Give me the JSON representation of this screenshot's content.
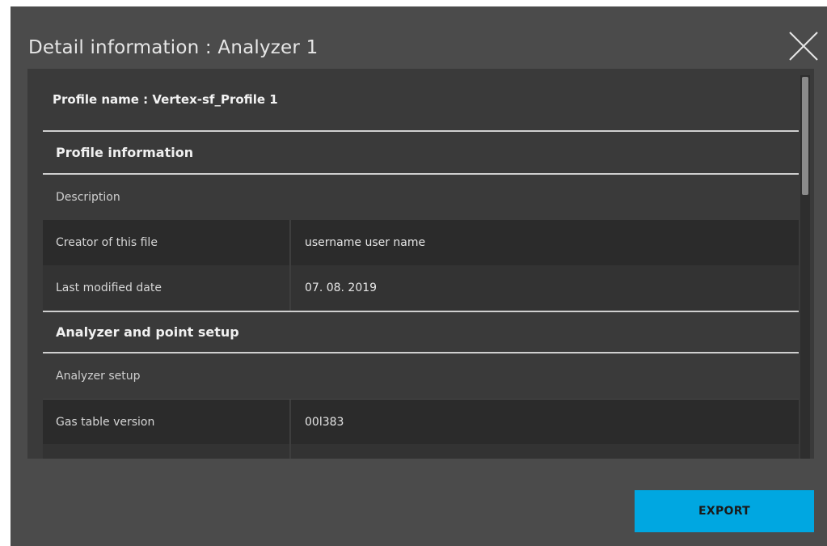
{
  "dialog": {
    "title": "Detail information : Analyzer 1",
    "close_icon": "close-icon"
  },
  "profile": {
    "name_label": "Profile name : Vertex-sf_Profile 1"
  },
  "sections": {
    "profile_information": {
      "header": "Profile information",
      "sub_header": "Description",
      "rows": [
        {
          "label": "Creator of this file",
          "value": "username user name"
        },
        {
          "label": "Last modified date",
          "value": "07. 08. 2019"
        }
      ]
    },
    "analyzer_point_setup": {
      "header": "Analyzer and point setup",
      "sub_header": "Analyzer setup",
      "rows": [
        {
          "label": "Gas table version",
          "value": "00l383"
        },
        {
          "label": "",
          "value": ""
        }
      ]
    }
  },
  "actions": {
    "export_label": "EXPORT"
  },
  "colors": {
    "dialog_bg": "#4b4b4b",
    "panel_bg": "#3a3a3a",
    "accent": "#00a7e1"
  }
}
